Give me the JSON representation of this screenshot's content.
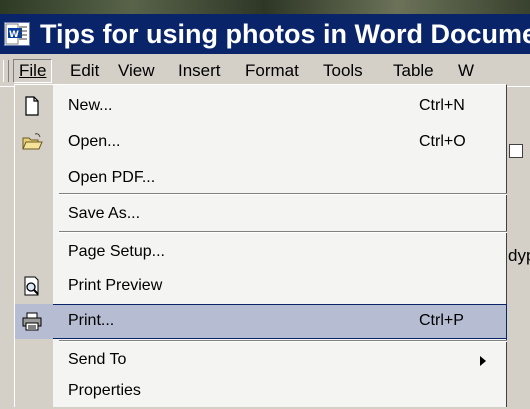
{
  "window": {
    "title": "Tips for using photos in Word Documents"
  },
  "menubar": {
    "items": [
      {
        "label": "File",
        "active": true
      },
      {
        "label": "Edit"
      },
      {
        "label": "View"
      },
      {
        "label": "Insert"
      },
      {
        "label": "Format"
      },
      {
        "label": "Tools"
      },
      {
        "label": "Table"
      },
      {
        "label": "W"
      }
    ]
  },
  "document": {
    "toolbar_fragment_text": "dyp"
  },
  "file_menu": {
    "items": [
      {
        "label": "New...",
        "shortcut": "Ctrl+N",
        "icon": "new-document-icon"
      },
      {
        "label": "Open...",
        "shortcut": "Ctrl+O",
        "icon": "open-folder-icon"
      },
      {
        "label": "Open PDF..."
      },
      {
        "label": "Save As..."
      },
      {
        "label": "Page Setup..."
      },
      {
        "label": "Print Preview",
        "icon": "print-preview-icon"
      },
      {
        "label": "Print...",
        "shortcut": "Ctrl+P",
        "icon": "printer-icon",
        "selected": true
      },
      {
        "label": "Send To",
        "submenu": true
      },
      {
        "label": "Properties"
      }
    ]
  },
  "colors": {
    "titlebar": "#0a246a",
    "menu_background": "#f4f4f2",
    "selection": "#b6bdd2",
    "chrome": "#d4d0c8"
  }
}
